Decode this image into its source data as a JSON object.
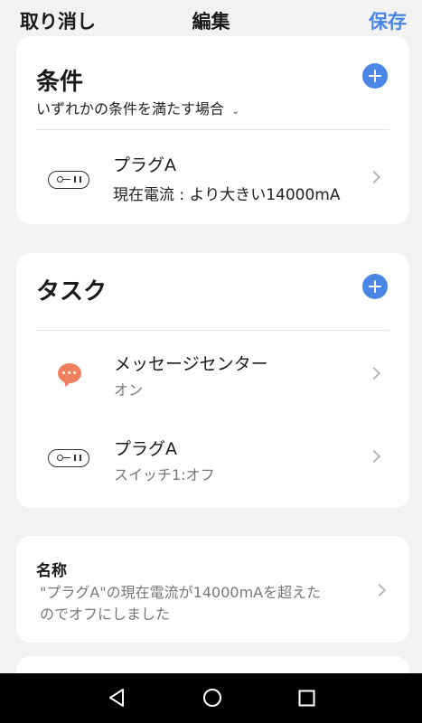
{
  "header": {
    "cancel_label": "取り消し",
    "title": "編集",
    "save_label": "保存"
  },
  "conditions": {
    "title": "条件",
    "match_mode": "いずれかの条件を満たす場合",
    "items": [
      {
        "device": "プラグA",
        "detail": "現在電流 : より大きい14000mA"
      }
    ]
  },
  "tasks": {
    "title": "タスク",
    "items": [
      {
        "name": "メッセージセンター",
        "state": "オン"
      },
      {
        "name": "プラグA",
        "state": "スイッチ1:オフ"
      }
    ]
  },
  "name_section": {
    "label": "名称",
    "value_line1": "\"プラグA\"の現在電流が14000mAを超えた",
    "value_line2": "のでオフにしました"
  },
  "colors": {
    "accent": "#4a86e6",
    "message_icon": "#f07f5d",
    "background": "#f2f2f2"
  }
}
